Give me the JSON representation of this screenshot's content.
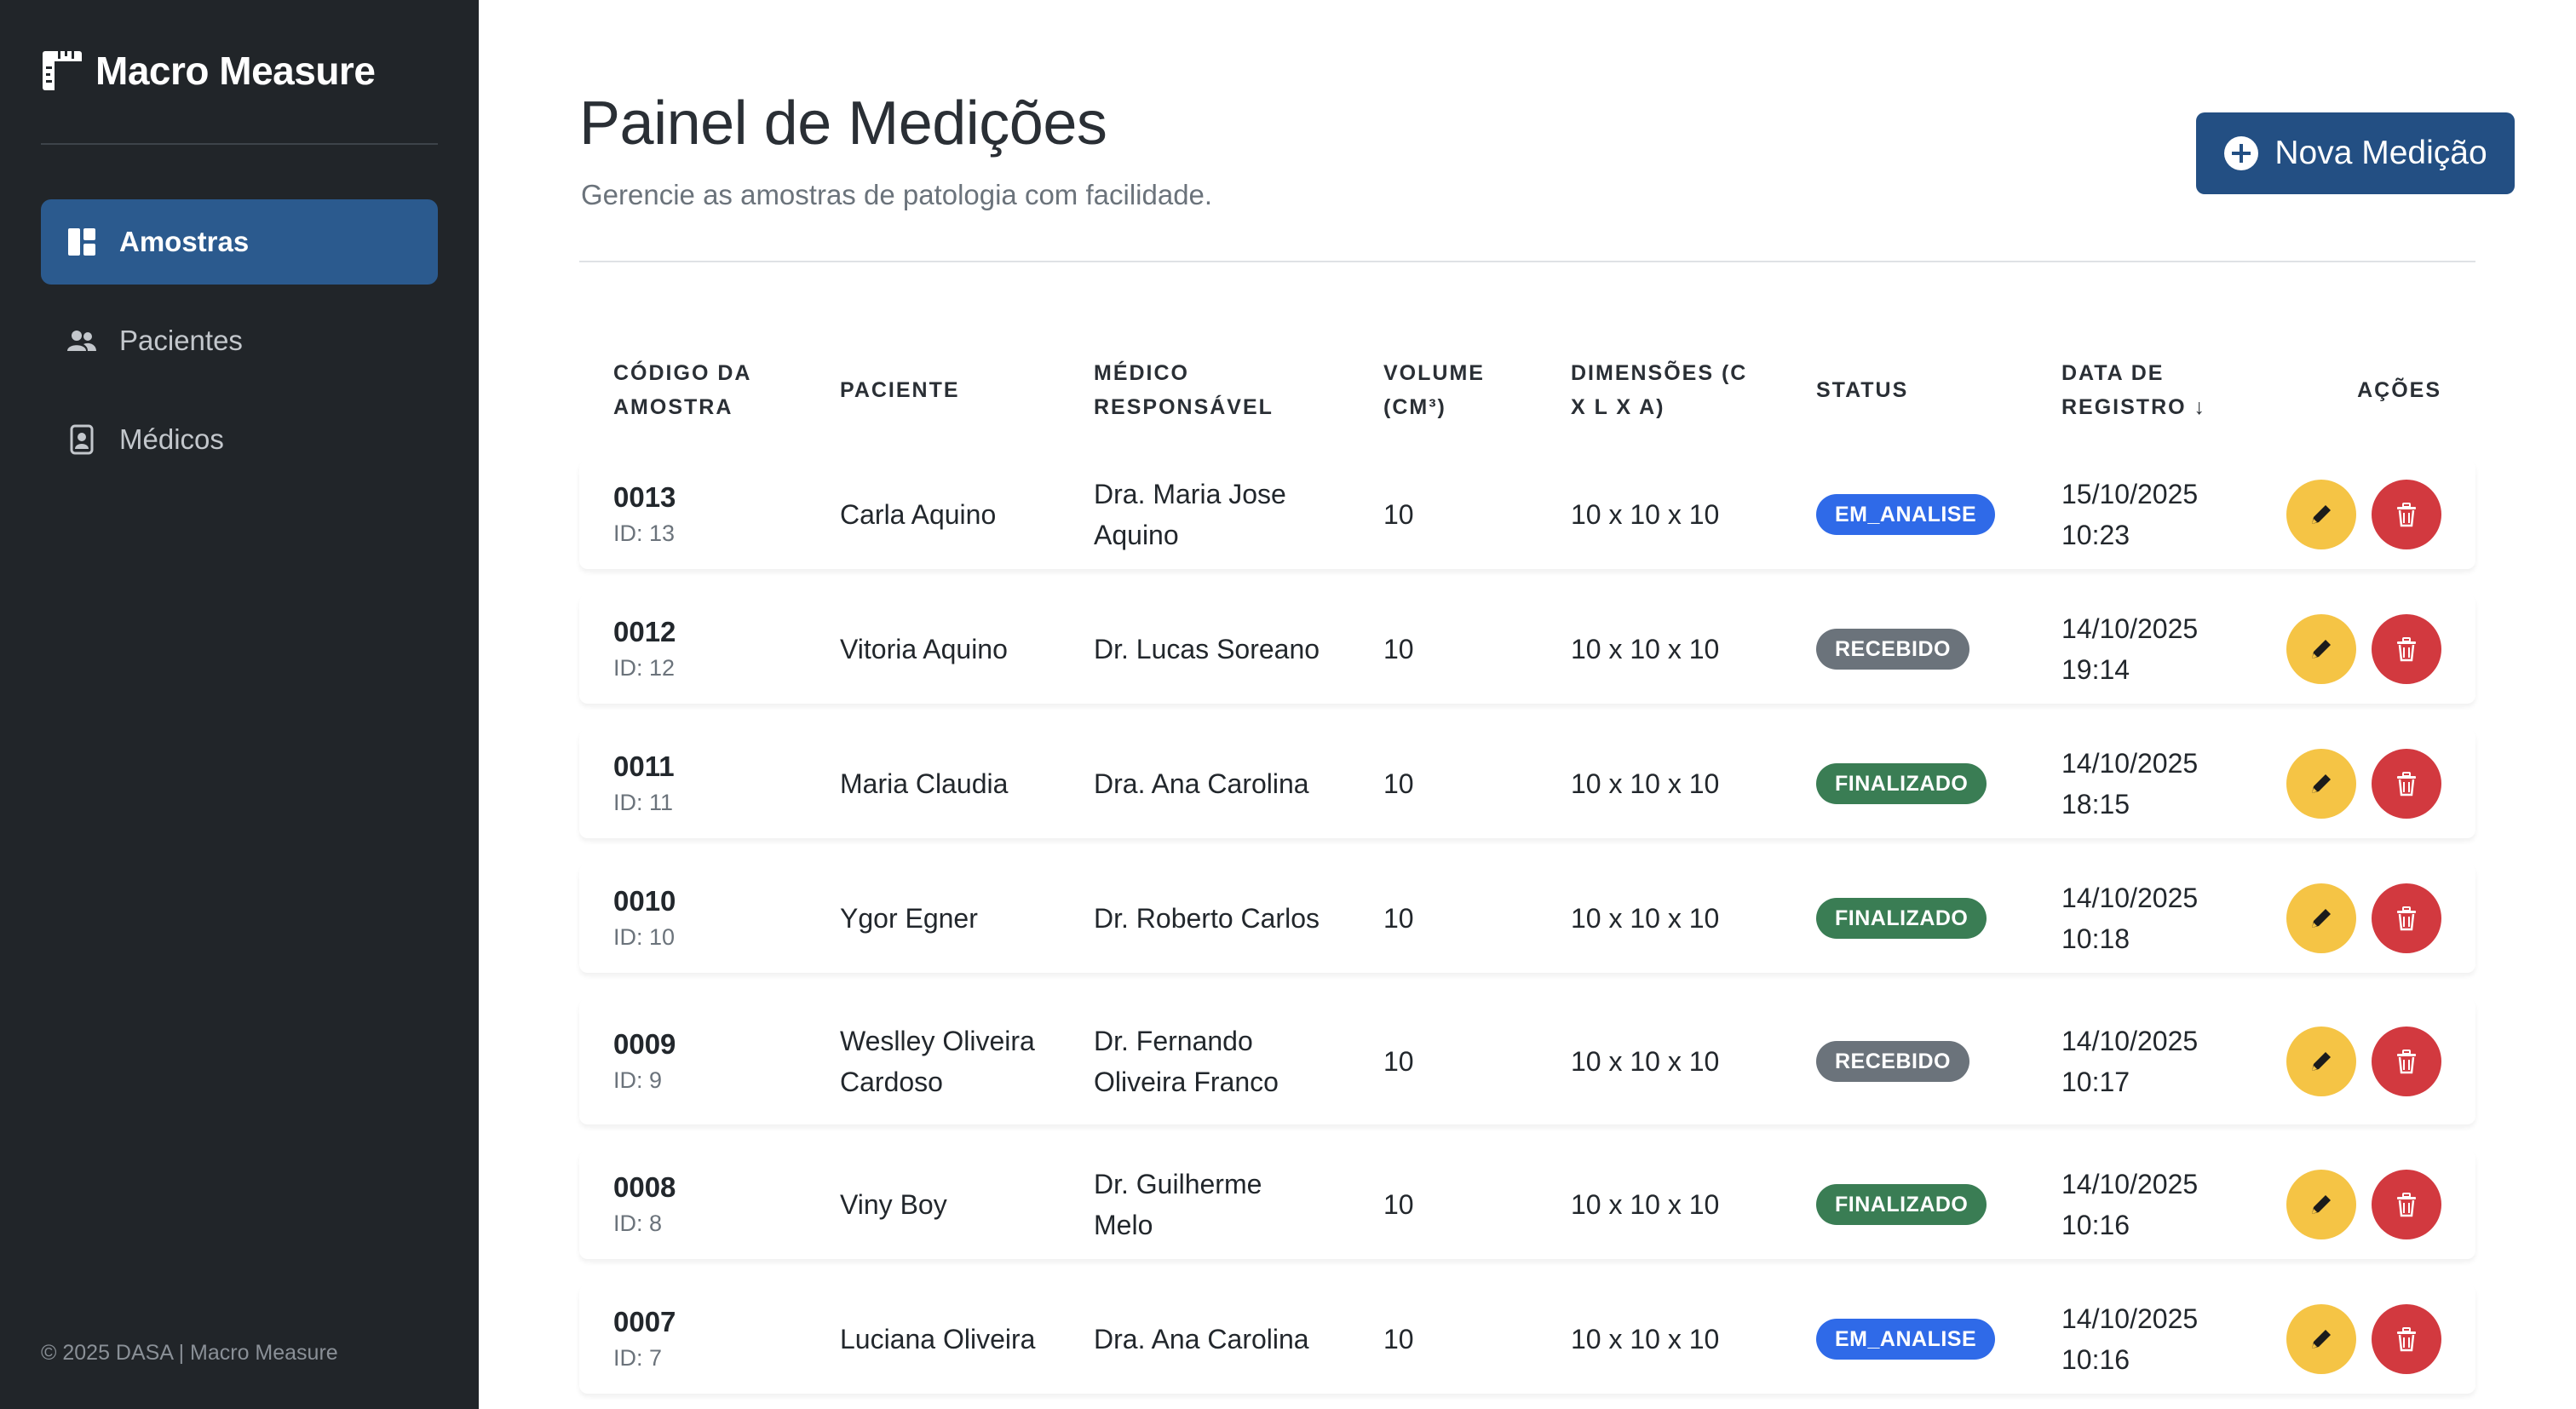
{
  "app": {
    "name": "Macro Measure",
    "footer": "© 2025 DASA | Macro Measure"
  },
  "sidebar": {
    "items": [
      {
        "label": "Amostras",
        "icon": "dashboard-icon",
        "active": true
      },
      {
        "label": "Pacientes",
        "icon": "people-icon",
        "active": false
      },
      {
        "label": "Médicos",
        "icon": "person-badge-icon",
        "active": false
      }
    ]
  },
  "header": {
    "title": "Painel de Medições",
    "subtitle": "Gerencie as amostras de patologia com facilidade.",
    "new_button_label": "Nova Medição"
  },
  "table": {
    "headers": {
      "code": "CÓDIGO DA AMOSTRA",
      "patient": "PACIENTE",
      "doctor": "MÉDICO RESPONSÁVEL",
      "volume": "VOLUME (CM³)",
      "dimensions": "DIMENSÕES (C X L X A)",
      "status": "STATUS",
      "date": "DATA DE REGISTRO ↓",
      "actions": "AÇÕES"
    },
    "rows": [
      {
        "code": "0013",
        "id": "ID: 13",
        "patient": "Carla Aquino",
        "doctor": "Dra. Maria Jose Aquino",
        "volume": "10",
        "dimensions": "10 x 10 x 10",
        "status": "EM_ANALISE",
        "date": "15/10/2025 10:23"
      },
      {
        "code": "0012",
        "id": "ID: 12",
        "patient": "Vitoria Aquino",
        "doctor": "Dr. Lucas Soreano",
        "volume": "10",
        "dimensions": "10 x 10 x 10",
        "status": "RECEBIDO",
        "date": "14/10/2025 19:14"
      },
      {
        "code": "0011",
        "id": "ID: 11",
        "patient": "Maria Claudia",
        "doctor": "Dra. Ana Carolina",
        "volume": "10",
        "dimensions": "10 x 10 x 10",
        "status": "FINALIZADO",
        "date": "14/10/2025 18:15"
      },
      {
        "code": "0010",
        "id": "ID: 10",
        "patient": "Ygor Egner",
        "doctor": "Dr. Roberto Carlos",
        "volume": "10",
        "dimensions": "10 x 10 x 10",
        "status": "FINALIZADO",
        "date": "14/10/2025 10:18"
      },
      {
        "code": "0009",
        "id": "ID: 9",
        "patient": "Weslley Oliveira Cardoso",
        "doctor": "Dr. Fernando Oliveira Franco",
        "volume": "10",
        "dimensions": "10 x 10 x 10",
        "status": "RECEBIDO",
        "date": "14/10/2025 10:17"
      },
      {
        "code": "0008",
        "id": "ID: 8",
        "patient": "Viny Boy",
        "doctor": "Dr. Guilherme Melo",
        "volume": "10",
        "dimensions": "10 x 10 x 10",
        "status": "FINALIZADO",
        "date": "14/10/2025 10:16"
      },
      {
        "code": "0007",
        "id": "ID: 7",
        "patient": "Luciana Oliveira",
        "doctor": "Dra. Ana Carolina",
        "volume": "10",
        "dimensions": "10 x 10 x 10",
        "status": "EM_ANALISE",
        "date": "14/10/2025 10:16"
      }
    ]
  },
  "colors": {
    "sidebar_bg": "#212529",
    "primary": "#234f83",
    "EM_ANALISE": "#2f6ae8",
    "RECEBIDO": "#6b737b",
    "FINALIZADO": "#3a7d54",
    "edit": "#f5c445",
    "delete": "#d2393f"
  }
}
